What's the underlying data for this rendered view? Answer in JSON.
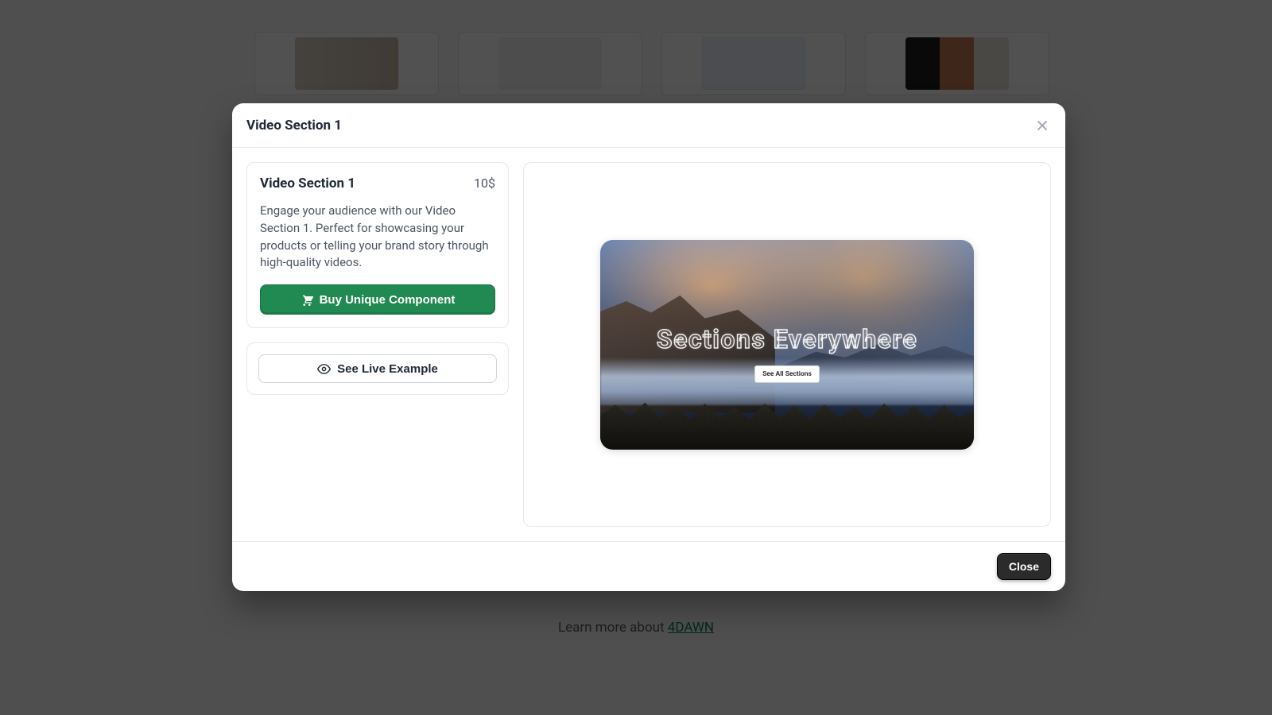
{
  "background": {
    "learn_prefix": "Learn more about ",
    "learn_link": "4DAWN"
  },
  "modal": {
    "title": "Video Section 1",
    "close_x": "×",
    "info": {
      "title": "Video Section 1",
      "price": "10$",
      "description": "Engage your audience with our Video Section 1. Perfect for showcasing your products or telling your brand story through high-quality videos.",
      "buy_label": "Buy Unique Component"
    },
    "example": {
      "label": "See Live Example"
    },
    "preview": {
      "headline": "Sections Everywhere",
      "cta": "See All Sections"
    },
    "footer": {
      "close_label": "Close"
    }
  },
  "colors": {
    "accent_green": "#218952",
    "text_muted": "#4b5563",
    "border": "#e5e7eb"
  }
}
